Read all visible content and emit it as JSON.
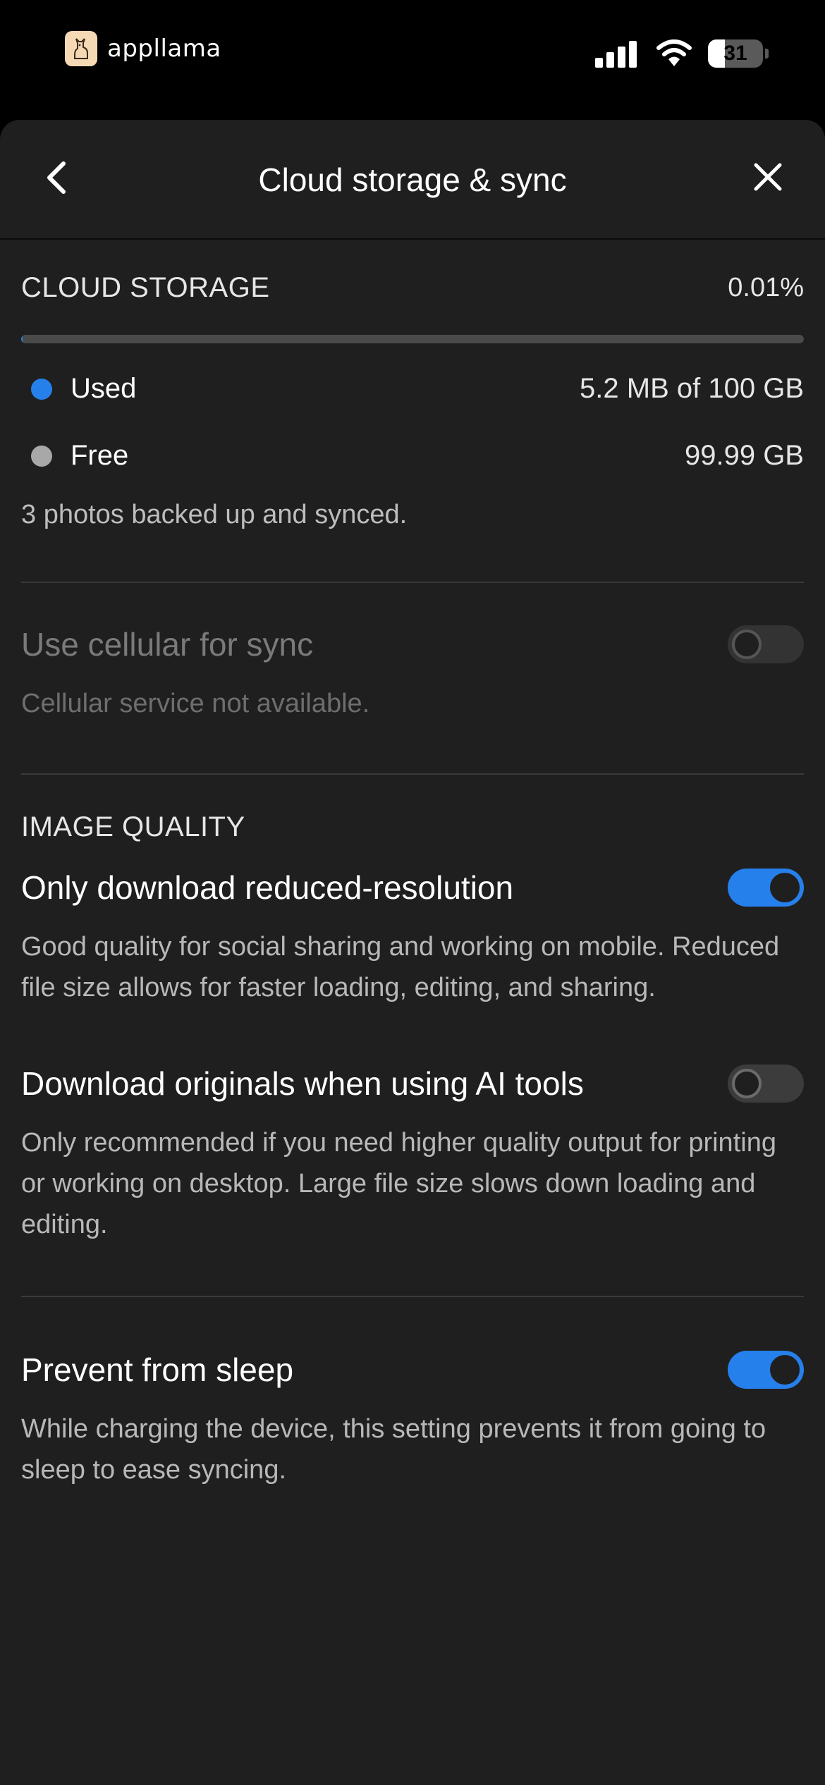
{
  "status_bar": {
    "brand_name": "appllama",
    "battery": "31",
    "battery_level": 0.31
  },
  "header": {
    "title": "Cloud storage & sync",
    "back_icon": "chevron-left-icon",
    "close_icon": "close-icon"
  },
  "cloud_storage": {
    "label": "CLOUD STORAGE",
    "percent": "0.01%",
    "used_fraction": 0.0001,
    "used": {
      "label": "Used",
      "value": "5.2 MB of 100 GB",
      "color": "#2680eb"
    },
    "free": {
      "label": "Free",
      "value": "99.99 GB",
      "color": "#a8a8a8"
    },
    "note": "3 photos backed up and synced."
  },
  "cellular": {
    "title": "Use cellular for sync",
    "description": "Cellular service not available.",
    "enabled": false,
    "disabled": true
  },
  "image_quality": {
    "label": "IMAGE QUALITY",
    "reduced": {
      "title": "Only download reduced-resolution",
      "description": "Good quality for social sharing and working on mobile. Reduced file size allows for faster loading, editing, and sharing.",
      "enabled": true
    },
    "originals": {
      "title": "Download originals when using AI tools",
      "description": "Only recommended if you need higher quality output for printing or working on desktop. Large file size slows down loading and editing.",
      "enabled": false
    }
  },
  "sleep": {
    "title": "Prevent from sleep",
    "description": "While charging the device, this setting prevents it from going to sleep to ease syncing.",
    "enabled": true
  },
  "colors": {
    "accent": "#2680eb",
    "background": "#1f1f1f"
  }
}
